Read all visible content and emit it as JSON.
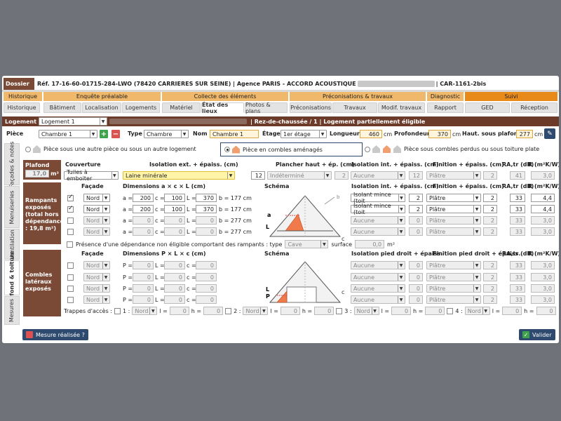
{
  "dossier": {
    "label": "Dossier",
    "ref_prefix": "Réf. 17-16-60-01715-284-LWO (78420 CARRIERES SUR SEINE) | Agence PARIS - ACCORD ACOUSTIQUE",
    "ref_suffix": "| CAR-1161-2bis"
  },
  "categories": [
    "Historique",
    "Enquête préalable",
    "Collecte des éléments",
    "Préconisations & travaux",
    "Diagnostic",
    "Suivi"
  ],
  "tabs": [
    "Historique",
    "Bâtiment",
    "Localisation",
    "Logements",
    "Matériel",
    "État des lieux",
    "Photos & plans",
    "Préconisations",
    "Travaux",
    "Modif. travaux",
    "Rapport",
    "GED",
    "Réception"
  ],
  "logement": {
    "label": "Logement",
    "value": "Logement 1",
    "floor_info": "| Rez-de-chaussée / 1 | Logement partiellement éligible"
  },
  "piece": {
    "label": "Pièce",
    "value": "Chambre 1",
    "type_label": "Type",
    "type_value": "Chambre",
    "nom_label": "Nom",
    "nom_value": "Chambre 1",
    "etage_label": "Étage",
    "etage_value": "1er étage",
    "longueur_label": "Longueur",
    "longueur_value": "460",
    "profondeur_label": "Profondeur",
    "profondeur_value": "370",
    "hsp_label": "Haut. sous plafond",
    "hsp_value": "277",
    "unit": "cm"
  },
  "radios": [
    "Pièce sous une autre pièce ou sous un autre logement",
    "Pièce en combles aménagés",
    "Pièce sous combles perdus ou sous toiture plate"
  ],
  "sidetabs": [
    "Façades & notes",
    "Menuiseries",
    "Ventilation",
    "Plafond & toiture",
    "Mesures"
  ],
  "plafond": {
    "label": "Plafond",
    "surface": "17,0",
    "unit": "m²",
    "h_couverture": "Couverture",
    "h_isolation_ext": "Isolation ext. + épaiss. (cm)",
    "h_plancher": "Plancher haut + ép. (cm)",
    "h_isolation_int": "Isolation int. + épaiss. (cm)",
    "h_finition": "Finition + épaiss. (cm)",
    "h_ra": "RA,tr (dB)",
    "h_r": "R (m²K/W)",
    "couverture": "Tuiles à emboiter",
    "isolation_ext": "Laine minérale",
    "isolation_ext_ep": "12",
    "plancher": "Indéterminé",
    "plancher_ep": "2",
    "isolation_int": "Aucune",
    "isolation_int_ep": "12",
    "finition": "Plâtre",
    "finition_ep": "2",
    "ra": "41",
    "r": "3,0"
  },
  "rampants": {
    "label": "Rampants exposés (total hors dépendance : 19,8 m²)",
    "h_facade": "Façade",
    "h_dims": "Dimensions a × c × L (cm)",
    "h_schema": "Schéma",
    "h_isolation": "Isolation int. + épaiss. (cm)",
    "h_finition": "Finition + épaiss. (cm)",
    "h_ra": "RA,tr (dB)",
    "h_r": "R (m²K/W)",
    "rows": [
      {
        "checked": true,
        "facade": "Nord",
        "a": "200",
        "c": "100",
        "L": "370",
        "b": "b = 177 cm",
        "isolation": "Isolant mince (toit",
        "iso_ep": "2",
        "finition": "Plâtre",
        "fin_ep": "2",
        "ra": "33",
        "r": "4,4"
      },
      {
        "checked": true,
        "facade": "Nord",
        "a": "200",
        "c": "100",
        "L": "370",
        "b": "b = 177 cm",
        "isolation": "Isolant mince (toit",
        "iso_ep": "2",
        "finition": "Plâtre",
        "fin_ep": "2",
        "ra": "33",
        "r": "4,4"
      },
      {
        "checked": false,
        "facade": "Nord",
        "a": "0",
        "c": "0",
        "L": "0",
        "b": "b = 277 cm",
        "isolation": "Aucune",
        "iso_ep": "0",
        "finition": "Plâtre",
        "fin_ep": "2",
        "ra": "33",
        "r": "3,0"
      },
      {
        "checked": false,
        "facade": "Nord",
        "a": "0",
        "c": "0",
        "L": "0",
        "b": "b = 277 cm",
        "isolation": "Aucune",
        "iso_ep": "0",
        "finition": "Plâtre",
        "fin_ep": "2",
        "ra": "33",
        "r": "3,0"
      }
    ],
    "dependance_label": "Présence d'une dépendance non éligible comportant des rampants : type",
    "dependance_type": "Cave",
    "surface_label": "surface",
    "surface_value": "0,0",
    "surface_unit": "m²"
  },
  "combles": {
    "label": "Combles latéraux exposés",
    "h_facade": "Façade",
    "h_dims": "Dimensions P × L × c (cm)",
    "h_schema": "Schéma",
    "h_isolation": "Isolation pied droit + épaiss.",
    "h_finition": "Finition pied droit + épaiss.",
    "h_ra": "RA,tr (dB)",
    "h_r": "R (m²K/W)",
    "rows": [
      {
        "facade": "Nord",
        "P": "0",
        "L": "0",
        "c": "0",
        "isolation": "Aucune",
        "iso_ep": "0",
        "finition": "Plâtre",
        "fin_ep": "2",
        "ra": "33",
        "r": "3,0"
      },
      {
        "facade": "Nord",
        "P": "0",
        "L": "0",
        "c": "0",
        "isolation": "Aucune",
        "iso_ep": "0",
        "finition": "Plâtre",
        "fin_ep": "2",
        "ra": "33",
        "r": "3,0"
      },
      {
        "facade": "Nord",
        "P": "0",
        "L": "0",
        "c": "0",
        "isolation": "Aucune",
        "iso_ep": "0",
        "finition": "Plâtre",
        "fin_ep": "2",
        "ra": "33",
        "r": "3,0"
      },
      {
        "facade": "Nord",
        "P": "0",
        "L": "0",
        "c": "0",
        "isolation": "Aucune",
        "iso_ep": "0",
        "finition": "Plâtre",
        "fin_ep": "2",
        "ra": "33",
        "r": "3,0"
      }
    ],
    "trappes_label": "Trappes d'accès :",
    "trappes": [
      {
        "n": "1 :",
        "facade": "Nord",
        "l": "0",
        "h": "0"
      },
      {
        "n": "2 :",
        "facade": "Nord",
        "l": "0",
        "h": "0"
      },
      {
        "n": "3 :",
        "facade": "Nord",
        "l": "0",
        "h": "0"
      },
      {
        "n": "4 :",
        "facade": "Nord",
        "l": "0",
        "h": "0"
      }
    ]
  },
  "footer": {
    "mesure_label": "Mesure réalisée ?",
    "valider_label": "Valider"
  },
  "colors": {
    "brown": "#7b4a37",
    "orange_band": "#f0b86a",
    "active_orange": "#e88a1a",
    "green": "#3fa34d",
    "navy": "#2e4a6e"
  }
}
